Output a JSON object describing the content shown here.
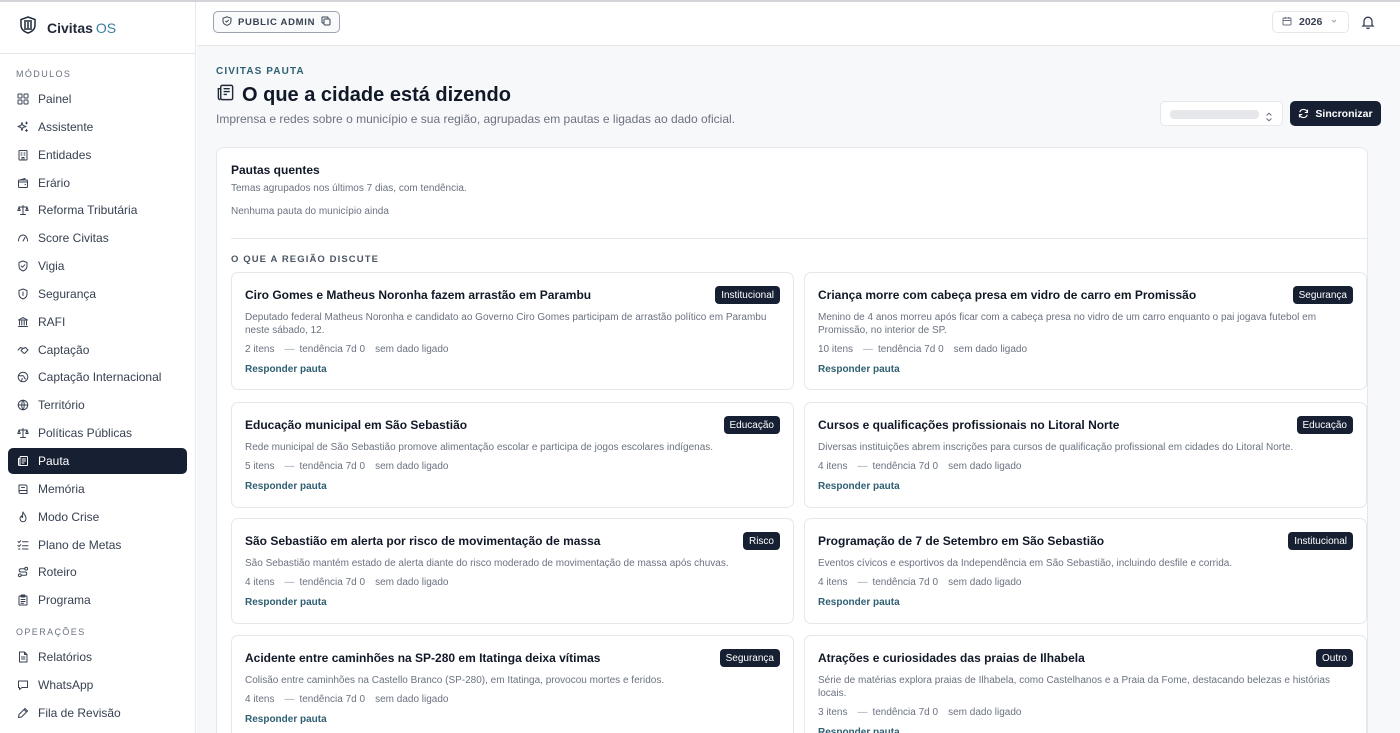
{
  "app": {
    "brand": "Civitas",
    "brand_suffix": "OS"
  },
  "sidebar": {
    "modules_title": "MÓDULOS",
    "items": [
      {
        "label": "Painel",
        "icon": "grid-icon"
      },
      {
        "label": "Assistente",
        "icon": "sparkles-icon"
      },
      {
        "label": "Entidades",
        "icon": "building-icon"
      },
      {
        "label": "Erário",
        "icon": "wallet-icon"
      },
      {
        "label": "Reforma Tributária",
        "icon": "scale-icon"
      },
      {
        "label": "Score Civitas",
        "icon": "gauge-icon"
      },
      {
        "label": "Vigia",
        "icon": "shield-check-icon"
      },
      {
        "label": "Segurança",
        "icon": "shield-icon"
      },
      {
        "label": "RAFI",
        "icon": "bank-icon"
      },
      {
        "label": "Captação",
        "icon": "handshake-icon"
      },
      {
        "label": "Captação Internacional",
        "icon": "globe-alt-icon"
      },
      {
        "label": "Território",
        "icon": "globe-icon"
      },
      {
        "label": "Políticas Públicas",
        "icon": "scale-icon"
      },
      {
        "label": "Pauta",
        "icon": "newspaper-icon",
        "active": true
      },
      {
        "label": "Memória",
        "icon": "book-icon"
      },
      {
        "label": "Modo Crise",
        "icon": "flame-icon"
      },
      {
        "label": "Plano de Metas",
        "icon": "list-checks-icon"
      },
      {
        "label": "Roteiro",
        "icon": "route-icon"
      },
      {
        "label": "Programa",
        "icon": "clipboard-icon"
      }
    ],
    "ops_title": "OPERAÇÕES",
    "ops_items": [
      {
        "label": "Relatórios",
        "icon": "file-text-icon"
      },
      {
        "label": "WhatsApp",
        "icon": "message-icon"
      },
      {
        "label": "Fila de Revisão",
        "icon": "pen-icon"
      }
    ]
  },
  "topbar": {
    "admin_label": "PUBLIC ADMIN",
    "year": "2026"
  },
  "page": {
    "eyebrow": "CIVITAS PAUTA",
    "title": "O que a cidade está dizendo",
    "subtitle": "Imprensa e redes sobre o município e sua região, agrupadas em pautas e ligadas ao dado oficial.",
    "sync_label": "Sincronizar"
  },
  "hot": {
    "title": "Pautas quentes",
    "subtitle": "Temas agrupados nos últimos 7 dias, com tendência.",
    "empty": "Nenhuma pauta do município ainda"
  },
  "region": {
    "title": "O QUE A REGIÃO DISCUTE",
    "cards": [
      {
        "title": "Ciro Gomes e Matheus Noronha fazem arrastão em Parambu",
        "tag": "Institucional",
        "desc": "Deputado federal Matheus Noronha e candidato ao Governo Ciro Gomes participam de arrastão político em Parambu neste sábado, 12.",
        "items": "2 itens",
        "trend": "tendência 7d 0",
        "nodata": "sem dado ligado",
        "link": "Responder pauta"
      },
      {
        "title": "Criança morre com cabeça presa em vidro de carro em Promissão",
        "tag": "Segurança",
        "desc": "Menino de 4 anos morreu após ficar com a cabeça presa no vidro de um carro enquanto o pai jogava futebol em Promissão, no interior de SP.",
        "items": "10 itens",
        "trend": "tendência 7d 0",
        "nodata": "sem dado ligado",
        "link": "Responder pauta"
      },
      {
        "title": "Educação municipal em São Sebastião",
        "tag": "Educação",
        "desc": "Rede municipal de São Sebastião promove alimentação escolar e participa de jogos escolares indígenas.",
        "items": "5 itens",
        "trend": "tendência 7d 0",
        "nodata": "sem dado ligado",
        "link": "Responder pauta"
      },
      {
        "title": "Cursos e qualificações profissionais no Litoral Norte",
        "tag": "Educação",
        "desc": "Diversas instituições abrem inscrições para cursos de qualificação profissional em cidades do Litoral Norte.",
        "items": "4 itens",
        "trend": "tendência 7d 0",
        "nodata": "sem dado ligado",
        "link": "Responder pauta"
      },
      {
        "title": "São Sebastião em alerta por risco de movimentação de massa",
        "tag": "Risco",
        "desc": "São Sebastião mantém estado de alerta diante do risco moderado de movimentação de massa após chuvas.",
        "items": "4 itens",
        "trend": "tendência 7d 0",
        "nodata": "sem dado ligado",
        "link": "Responder pauta"
      },
      {
        "title": "Programação de 7 de Setembro em São Sebastião",
        "tag": "Institucional",
        "desc": "Eventos cívicos e esportivos da Independência em São Sebastião, incluindo desfile e corrida.",
        "items": "4 itens",
        "trend": "tendência 7d 0",
        "nodata": "sem dado ligado",
        "link": "Responder pauta"
      },
      {
        "title": "Acidente entre caminhões na SP-280 em Itatinga deixa vítimas",
        "tag": "Segurança",
        "desc": "Colisão entre caminhões na Castello Branco (SP-280), em Itatinga, provocou mortes e feridos.",
        "items": "4 itens",
        "trend": "tendência 7d 0",
        "nodata": "sem dado ligado",
        "link": "Responder pauta"
      },
      {
        "title": "Atrações e curiosidades das praias de Ilhabela",
        "tag": "Outro",
        "desc": "Série de matérias explora praias de Ilhabela, como Castelhanos e a Praia da Fome, destacando belezas e histórias locais.",
        "items": "3 itens",
        "trend": "tendência 7d 0",
        "nodata": "sem dado ligado",
        "link": "Responder pauta"
      }
    ]
  }
}
